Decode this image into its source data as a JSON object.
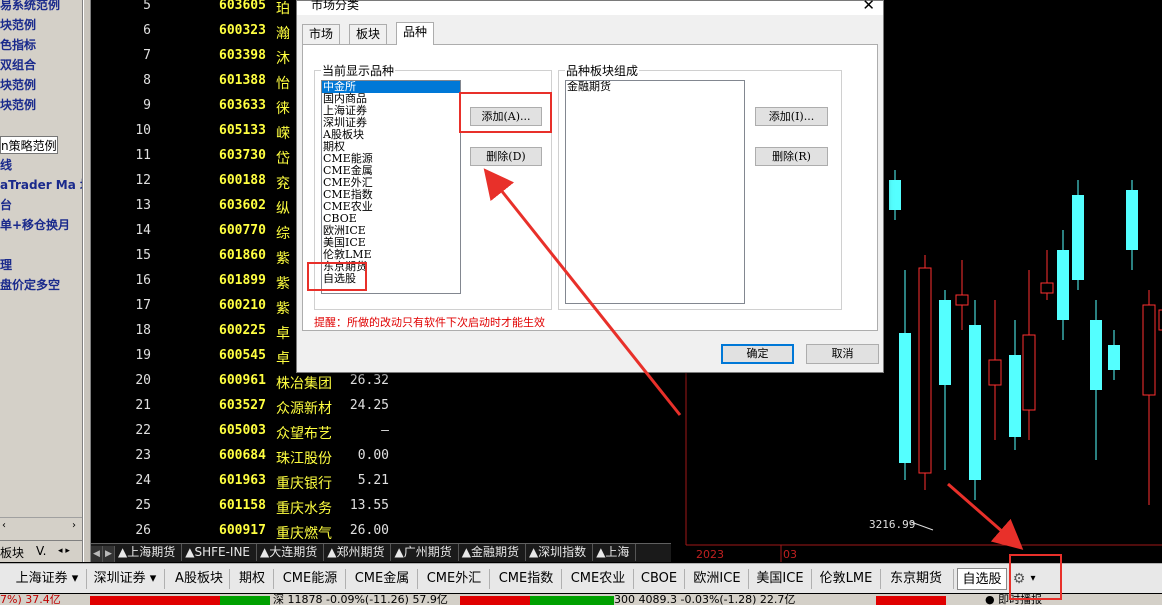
{
  "sidebar": {
    "items": [
      {
        "label": "易系统范例"
      },
      {
        "label": "块范例"
      },
      {
        "label": "色指标"
      },
      {
        "label": "双组合"
      },
      {
        "label": "块范例"
      },
      {
        "label": "块范例"
      },
      {
        "label": "n策略范例"
      },
      {
        "label": "线"
      },
      {
        "label": "aTrader Ma 均"
      },
      {
        "label": "台"
      },
      {
        "label": "单+移仓换月"
      },
      {
        "label": "理"
      },
      {
        "label": "盘价定多空"
      }
    ],
    "scroll_left": "‹",
    "scroll_right": "›",
    "tab_1": "板块",
    "tab_2": "V.",
    "tab_nav": "◂ ▸"
  },
  "table": {
    "rows": [
      {
        "num": "5",
        "code": "603605",
        "name": "珀",
        "price": ""
      },
      {
        "num": "6",
        "code": "600323",
        "name": "瀚",
        "price": ""
      },
      {
        "num": "7",
        "code": "603398",
        "name": "沐",
        "price": ""
      },
      {
        "num": "8",
        "code": "601388",
        "name": "怡",
        "price": ""
      },
      {
        "num": "9",
        "code": "603633",
        "name": "徕",
        "price": ""
      },
      {
        "num": "10",
        "code": "605133",
        "name": "嵘",
        "price": ""
      },
      {
        "num": "11",
        "code": "603730",
        "name": "岱",
        "price": ""
      },
      {
        "num": "12",
        "code": "600188",
        "name": "兖",
        "price": ""
      },
      {
        "num": "13",
        "code": "603602",
        "name": "纵",
        "price": ""
      },
      {
        "num": "14",
        "code": "600770",
        "name": "综",
        "price": ""
      },
      {
        "num": "15",
        "code": "601860",
        "name": "紫",
        "price": ""
      },
      {
        "num": "16",
        "code": "601899",
        "name": "紫",
        "price": ""
      },
      {
        "num": "17",
        "code": "600210",
        "name": "紫",
        "price": ""
      },
      {
        "num": "18",
        "code": "600225",
        "name": "卓",
        "price": ""
      },
      {
        "num": "19",
        "code": "600545",
        "name": "卓",
        "price": ""
      },
      {
        "num": "20",
        "code": "600961",
        "name": "株冶集团",
        "price": "26.32"
      },
      {
        "num": "21",
        "code": "603527",
        "name": "众源新材",
        "price": "24.25"
      },
      {
        "num": "22",
        "code": "605003",
        "name": "众望布艺",
        "price": "—"
      },
      {
        "num": "23",
        "code": "600684",
        "name": "珠江股份",
        "price": "0.00"
      },
      {
        "num": "24",
        "code": "601963",
        "name": "重庆银行",
        "price": "5.21"
      },
      {
        "num": "25",
        "code": "601158",
        "name": "重庆水务",
        "price": "13.55"
      },
      {
        "num": "26",
        "code": "600917",
        "name": "重庆燃气",
        "price": "26.00"
      }
    ]
  },
  "exchange_tabs": {
    "nav_first": "◀",
    "nav_next": "▶",
    "tabs": [
      "▲上海期货",
      "▲SHFE-INE",
      "▲大连期货",
      "▲郑州期货",
      "▲广州期货",
      "▲金融期货",
      "▲深圳指数",
      "▲上海"
    ]
  },
  "chart": {
    "price_label": "3216.99",
    "year_label": "2023",
    "month_label": "03",
    "up_color": "#ff3030",
    "down_color": "#54ffff"
  },
  "market_bar": {
    "items": [
      "上海证券 ▾",
      "深圳证券 ▾",
      "A股板块",
      "期权",
      "CME能源",
      "CME金属",
      "CME外汇",
      "CME指数",
      "CME农业",
      "CBOE",
      "欧洲ICE",
      "美国ICE",
      "伦敦LME",
      "东京期货",
      "自选股"
    ],
    "selected": "自选股",
    "settings_icon": "⚙",
    "dropdown_icon": "▾"
  },
  "status_bar": {
    "left_text": "7%)  37.4亿",
    "mid_text": "深  11878  -0.09%(-11.26)  57.9亿",
    "right_text": "300  4089.3  -0.03%(-1.28)  22.7亿",
    "far_text": "● 即时播报"
  },
  "dialog": {
    "title": "市场分类",
    "close": "✕",
    "tabs": [
      "市场",
      "板块",
      "品种"
    ],
    "active_tab": "品种",
    "left_group_label": "当前显示品种",
    "left_list": [
      "中金所",
      "国内商品",
      "上海证券",
      "深圳证券",
      "A股板块",
      "期权",
      "CME能源",
      "CME金属",
      "CME外汇",
      "CME指数",
      "CME农业",
      "CBOE",
      "欧洲ICE",
      "美国ICE",
      "伦敦LME",
      "东京期货",
      "自选股"
    ],
    "left_selected": "中金所",
    "add_left": "添加(A)...",
    "delete_left": "删除(D)",
    "right_group_label": "品种板块组成",
    "right_list": [
      "金融期货"
    ],
    "add_right": "添加(I)...",
    "delete_right": "删除(R)",
    "note": "提醒：所做的改动只有软件下次启动时才能生效",
    "ok": "确定",
    "cancel": "取消"
  }
}
